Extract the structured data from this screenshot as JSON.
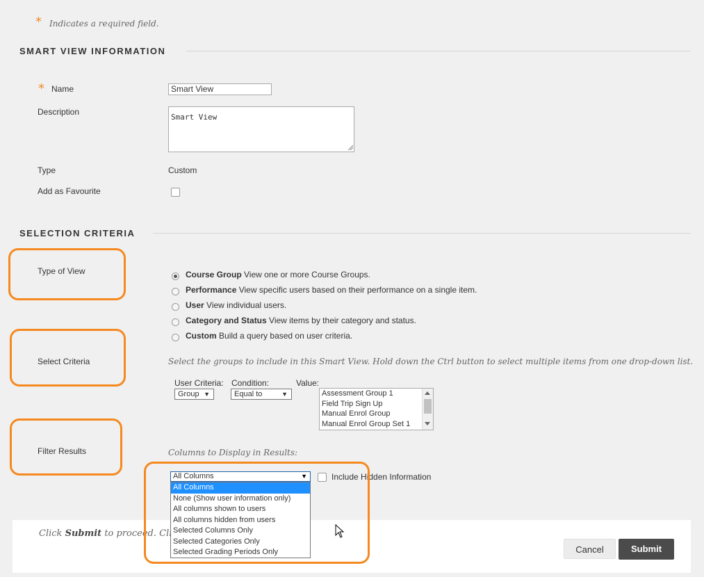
{
  "required_note": {
    "star": "*",
    "text": "Indicates a required field."
  },
  "smart_view_info": {
    "title": "SMART VIEW INFORMATION",
    "name_label": "Name",
    "name_value": "Smart View",
    "description_label": "Description",
    "description_value": "Smart View",
    "type_label": "Type",
    "type_value": "Custom",
    "favourite_label": "Add as Favourite"
  },
  "selection_criteria": {
    "title": "SELECTION CRITERIA",
    "type_of_view_label": "Type of View",
    "view_options": [
      {
        "bold": "Course Group",
        "desc": "View one or more Course Groups.",
        "checked": true
      },
      {
        "bold": "Performance",
        "desc": "View specific users based on their performance on a single item.",
        "checked": false
      },
      {
        "bold": "User",
        "desc": "View individual users.",
        "checked": false
      },
      {
        "bold": "Category and Status",
        "desc": "View items by their category and status.",
        "checked": false
      },
      {
        "bold": "Custom",
        "desc": "Build a query based on user criteria.",
        "checked": false
      }
    ],
    "select_criteria_label": "Select Criteria",
    "instructions": "Select the groups to include in this Smart View. Hold down the Ctrl button to select multiple items from one drop-down list.",
    "user_criteria_label": "User Criteria:",
    "user_criteria_value": "Group",
    "condition_label": "Condition:",
    "condition_value": "Equal to",
    "value_label": "Value:",
    "value_options": [
      "Assessment Group 1",
      "Field Trip Sign Up",
      "Manual Enrol Group",
      "Manual Enrol Group Set 1"
    ],
    "filter_results_label": "Filter Results",
    "columns_label": "Columns to Display in Results:",
    "columns_selected": "All Columns",
    "columns_options": [
      "All Columns",
      "None (Show user information only)",
      "All columns shown to users",
      "All columns hidden from users",
      "Selected Columns Only",
      "Selected Categories Only",
      "Selected Grading Periods Only"
    ],
    "include_hidden_label": "Include Hidden Information"
  },
  "footer": {
    "text_prefix": "Click ",
    "text_bold": "Submit",
    "text_suffix": " to proceed. Click",
    "cancel_label": "Cancel",
    "submit_label": "Submit"
  },
  "colors": {
    "accent_orange": "#f5891f",
    "submit_bg": "#4b4b4b",
    "selection_blue": "#1e90ff"
  },
  "icons": {
    "dropdown_arrow": "▼",
    "cursor": "mouse-pointer-icon"
  }
}
